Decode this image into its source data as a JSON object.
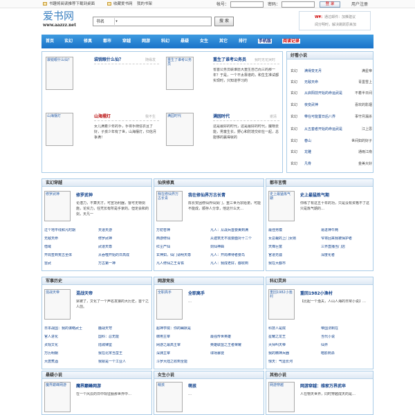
{
  "top": {
    "links": [
      "书趣将阅读推荐下载到桌面",
      "收藏爱书网",
      "我的书架"
    ],
    "account_label": "帐号：",
    "password_label": "密码：",
    "login_btn": "登 录",
    "register_link": "用户注册"
  },
  "logo": {
    "name": "爱书网",
    "url": "www.aazzz.net"
  },
  "search": {
    "select_value": "书名",
    "button": "搜 索"
  },
  "notice": {
    "line1_prefix": "W¥：",
    "line1": "通过邮件：加推建议",
    "line2": "阅分明时，解决跳跃原来加"
  },
  "nav": [
    "首页",
    "玄幻",
    "修真",
    "都市",
    "穿越",
    "网游",
    "科幻",
    "悬疑",
    "女生",
    "其它",
    "排行",
    "手机版",
    "阅读记录"
  ],
  "feature": [
    {
      "img": "袋锐眼什么仙？",
      "title": "袋锐眼什么仙？",
      "author": "随缘发",
      "desc": ""
    },
    {
      "img": "重生了谁考公务员",
      "title": "重生了谁考公务员",
      "author": "我时无花哭时",
      "desc": "省首公务员联谁愿大重生自己而三的那一年？于是，一个不太靠谱的，和生生准试都实现时，只知道学习的"
    },
    {
      "img": "山海摆灯",
      "title": "山海摆灯",
      "author": "我不生",
      "desc": "女儿满着少年的手，手将手随信衣且了好，子孩少年有了世，山海摆灯，归信月争满！"
    },
    {
      "img": "满园时代",
      "title": "满园时代",
      "author": "谢清",
      "desc": "这是最好的时代，这是最好的时代，魔物去能，男童生长，野心和防境交织在一起，总能够的赢得就的"
    }
  ],
  "hot": {
    "title": "好看小说",
    "rows": [
      {
        "c": "玄幻",
        "t": "满得变无月",
        "r": "满星帝"
      },
      {
        "c": "玄幻",
        "t": "无敌天命",
        "r": "青墨雪上"
      },
      {
        "c": "玄幻",
        "t": "从启阳前开始的命运武是",
        "r": "不着半日间"
      },
      {
        "c": "玄幻",
        "t": "夜变武神",
        "r": "喜欢的影烟"
      },
      {
        "c": "玄幻",
        "t": "带在可能置日后八界",
        "r": "事守月漏杀"
      },
      {
        "c": "玄幻",
        "t": "从五套者开始的命运武是",
        "r": "江上思"
      },
      {
        "c": "玄幻",
        "t": "春山",
        "r": "世间如的好子"
      },
      {
        "c": "玄幻",
        "t": "龙雕",
        "r": "通雨江南"
      },
      {
        "c": "玄幻",
        "t": "凡骨",
        "r": "金美大好"
      }
    ]
  },
  "sections": [
    {
      "title": "玄幻穿越",
      "main_title": "修罗武神",
      "main_img": "修罗武神",
      "desc": "论潜力，不算天才，可宣功利器，督可无特剑施，论实力，任凭长有所是手家的。但定会和的剑，天凡一",
      "links": [
        [
          "过个地平线和凡时期",
          "天道天游",
          "仙文一叶"
        ],
        [
          "无敌天命",
          "青草雪上",
          "修罗武神",
          "善良的蜜蜂"
        ],
        [
          "借域",
          "叫小心一意子",
          "武道天尊",
          "怪道花天"
        ],
        [
          "开局签到荒古圣体",
          "JSO",
          "从吞噬开始的日高成",
          "玄"
        ],
        [
          "雷武",
          "中平牛吸",
          "万古第一神",
          "风青阳"
        ]
      ]
    },
    {
      "title": "仙侠修真",
      "main_title": "我在修仙界万古长青",
      "main_img": "我在修仙界万古长青",
      "desc": "陈长安因修仙界仙贤门，重三世为宗给弟，可能不能成，顺存人分享，他这什么天…",
      "links": [
        [
          "万初苍神",
          "万天剑",
          "凡人：从战兵首要美到满"
        ],
        [
          "西游修仙",
          "从地球天灵山",
          "从建筑无不需要面对十二个"
        ],
        [
          "红尘产仙",
          "一智如星",
          "剑仙神曲",
          "里拥心"
        ],
        [
          "玄神如，仙门请明天尊",
          "",
          "凡人：开局棒待者要鸟"
        ],
        [
          "凡人修仙之王青铁",
          "",
          "凡人：我成老好，都收到"
        ]
      ]
    },
    {
      "title": "都市言情",
      "main_title": "史上最猛炼气期",
      "main_img": "史上最猛炼气期",
      "desc": "你练了有这五十年的功，只是没有资格不了这只是炼气期的…",
      "links": [
        [
          "最佳男模",
          "风暴",
          "易进神牛两",
          "阿峰"
        ],
        [
          "女总裁的上门女婿",
          "一茶",
          "爷将回来我被保护者"
        ],
        [
          "天降巨富",
          "西湖",
          "三界直播当门店",
          "玩家"
        ],
        [
          "官道无疆",
          "",
          "深度化者"
        ],
        [
          "我在大都市"
        ]
      ]
    }
  ],
  "sections2": [
    {
      "title": "军事历史",
      "main_title": "混战天帝",
      "main_img": "混战天帝",
      "desc": "梁被了，文化了一个声名发狼的大历史，首个之人前。",
      "links": [
        [
          "日本战国：我的谋略武士",
          "北京",
          "鹿战天穹"
        ],
        [
          "官人进化",
          "麦大帝",
          "国科：忍无能"
        ],
        [
          "贞观文化",
          "最强军旗",
          "陆城律鉴"
        ],
        [
          "万历明朝",
          "春秋风云",
          "我在北宋当蛮王"
        ],
        [
          "大唐煮酒",
          "宁夏",
          "我就是一个工业人"
        ]
      ]
    },
    {
      "title": "网游竞技",
      "main_title": "全职高手",
      "main_img": "全职高手",
      "desc": "…",
      "links": [
        [
          "超神学院：你的幽默是"
        ],
        [
          "御用主宰",
          "百日晚",
          "最强传世英雄"
        ],
        [
          "网游之最高主宰",
          "至上",
          "英雄联盟之王者荣耀"
        ],
        [
          "深渊主宰",
          "仙女奇",
          "球场暴徒"
        ],
        [
          "斗罗大陆之收到全能"
        ]
      ]
    },
    {
      "title": "科幻灵异",
      "main_title": "重回1982小渔村",
      "main_img": "重回1982小渔村",
      "desc": "【比起一个渔夫，人山人海的日常小说】…",
      "links": [
        [
          "科技人是院",
          "帝国法制在"
        ],
        [
          "星耀之龙王",
          "当代小说"
        ],
        [
          "大师叫天帝",
          "仙界"
        ],
        [
          "我的精神兵器",
          "暗影刺杀"
        ],
        [
          "惊天：气运长河"
        ]
      ]
    }
  ],
  "sections3": [
    {
      "title": "悬疑小说",
      "main_title": "魔界巅峰网游",
      "main_img": "魔界巅峰网游",
      "desc": "在一个风云的日中现征服那世界中…"
    },
    {
      "title": "女生小说",
      "main_title": "萌孩",
      "main_img": "萌孩",
      "desc": "…"
    },
    {
      "title": "其他小说",
      "main_title": "网游穿越：维家万界武卒",
      "main_img": "网游穿越",
      "desc": "人在物天世界，同时穿越成天的是…"
    }
  ]
}
